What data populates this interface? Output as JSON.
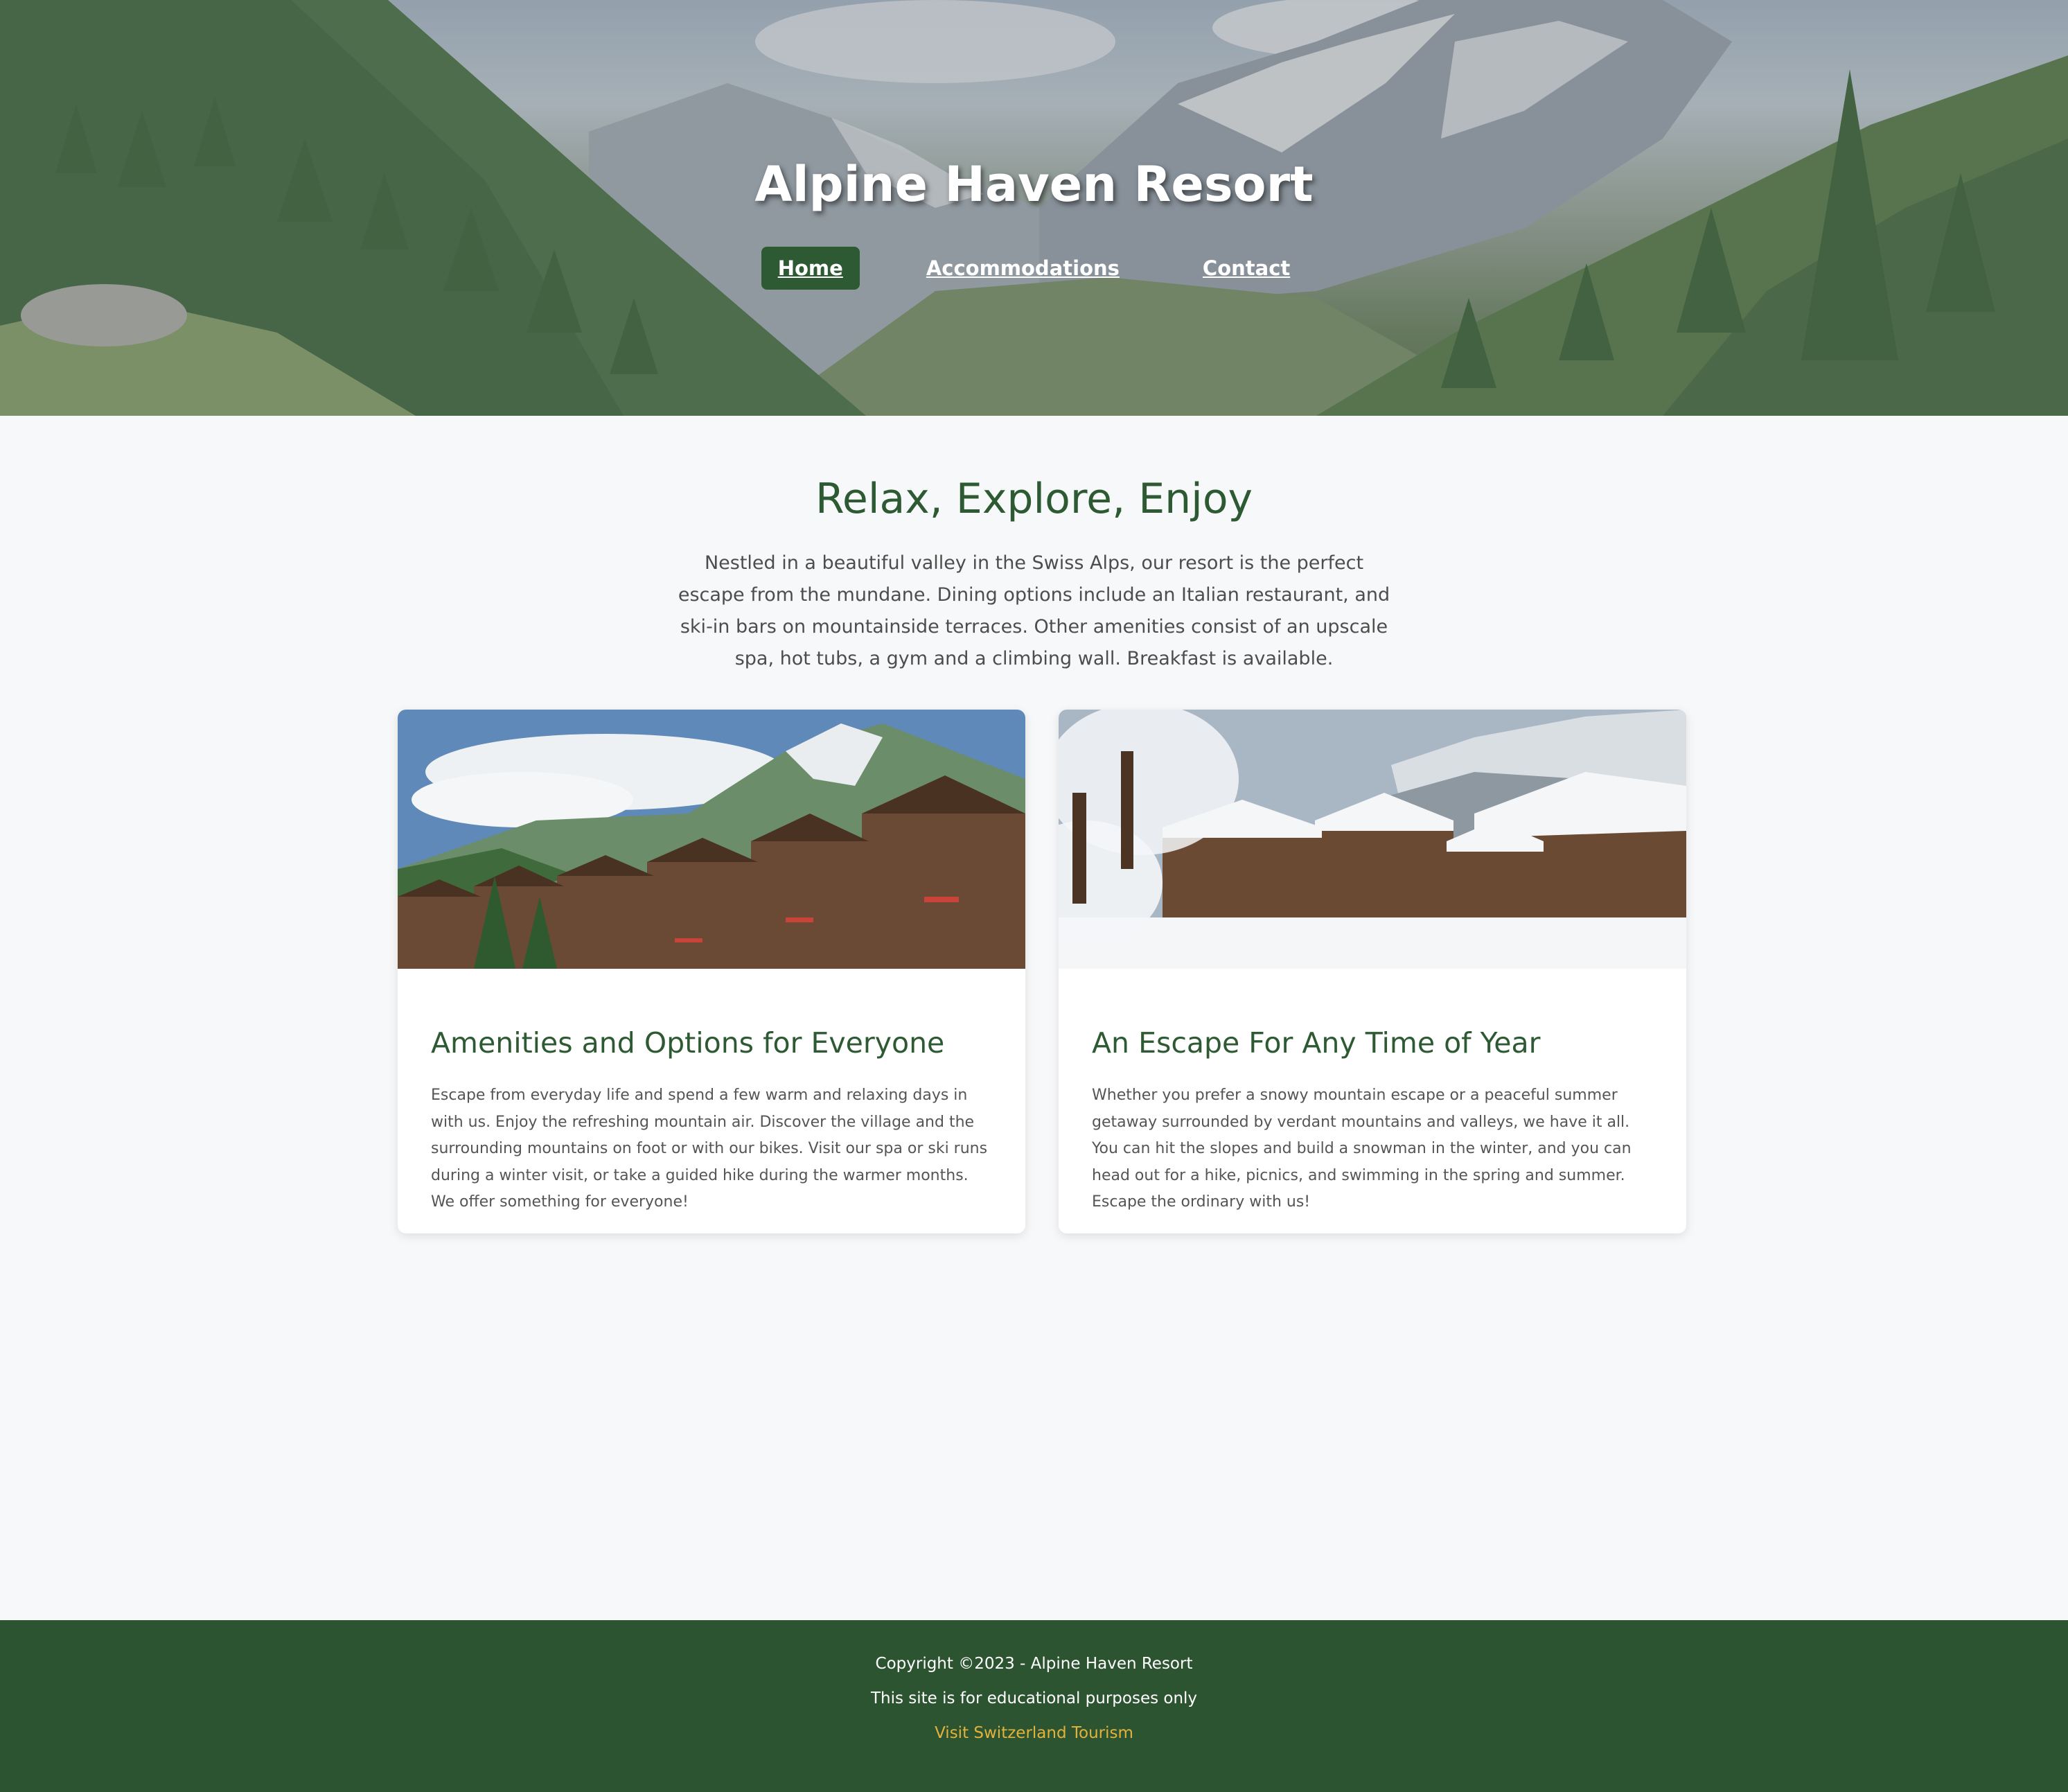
{
  "hero": {
    "title": "Alpine Haven Resort",
    "nav": [
      {
        "label": "Home",
        "active": true
      },
      {
        "label": "Accommodations",
        "active": false
      },
      {
        "label": "Contact",
        "active": false
      }
    ]
  },
  "intro": {
    "heading": "Relax, Explore, Enjoy",
    "text": "Nestled in a beautiful valley in the Swiss Alps, our resort is the perfect escape from the mundane. Dining options include an Italian restaurant, and ski-in bars on mountainside terraces. Other amenities consist of an upscale spa, hot tubs, a gym and a climbing wall. Breakfast is available."
  },
  "cards": [
    {
      "title": "Amenities and Options for Everyone",
      "body": "Escape from everyday life and spend a few warm and relaxing days in with us. Enjoy the refreshing mountain air. Discover the village and the surrounding mountains on foot or with our bikes. Visit our spa or ski runs during a winter visit, or take a guided hike during the warmer months. We offer something for everyone!"
    },
    {
      "title": "An Escape For Any Time of Year",
      "body": "Whether you prefer a snowy mountain escape or a peaceful summer getaway surrounded by verdant mountains and valleys, we have it all. You can hit the slopes and build a snowman in the winter, and you can head out for a hike, picnics, and swimming in the spring and summer. Escape the ordinary with us!"
    }
  ],
  "footer": {
    "copyright": "Copyright ©2023 - Alpine Haven Resort",
    "notice": "This site is for educational purposes only",
    "link": "Visit Switzerland Tourism"
  },
  "colors": {
    "brand_green": "#2d5a32",
    "footer_green": "#2d5430",
    "link_gold": "#e3b23c",
    "page_bg": "#f7f8f9"
  }
}
